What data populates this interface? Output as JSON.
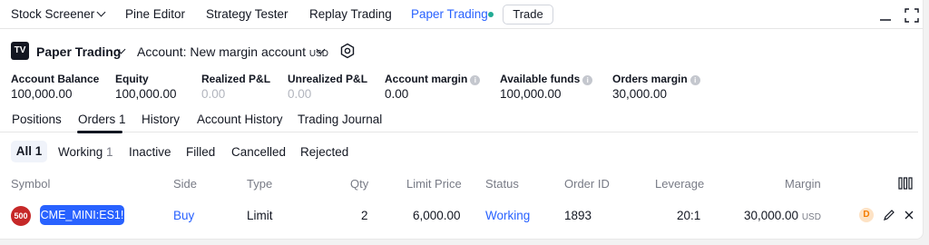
{
  "topbar": {
    "tabs": [
      "Stock Screener",
      "Pine Editor",
      "Strategy Tester",
      "Replay Trading",
      "Paper Trading"
    ],
    "trade_label": "Trade"
  },
  "account": {
    "title": "Paper Trading",
    "selector_label": "Account: New margin account",
    "currency": "USD"
  },
  "metrics": [
    {
      "label": "Account Balance",
      "value": "100,000.00"
    },
    {
      "label": "Equity",
      "value": "100,000.00"
    },
    {
      "label": "Realized P&L",
      "value": "0.00"
    },
    {
      "label": "Unrealized P&L",
      "value": "0.00"
    },
    {
      "label": "Account margin",
      "value": "0.00"
    },
    {
      "label": "Available funds",
      "value": "100,000.00"
    },
    {
      "label": "Orders margin",
      "value": "30,000.00"
    }
  ],
  "main_tabs": [
    "Positions",
    "Orders 1",
    "History",
    "Account History",
    "Trading Journal"
  ],
  "sub_tabs": {
    "all": "All 1",
    "working": "Working",
    "working_count": "1",
    "inactive": "Inactive",
    "filled": "Filled",
    "cancelled": "Cancelled",
    "rejected": "Rejected"
  },
  "table": {
    "columns": [
      "Symbol",
      "Side",
      "Type",
      "Qty",
      "Limit Price",
      "Status",
      "Order ID",
      "Leverage",
      "Margin"
    ],
    "row": {
      "badge": "500",
      "symbol": "CME_MINI:ES1!",
      "side": "Buy",
      "type": "Limit",
      "qty": "2",
      "limit_price": "6,000.00",
      "status": "Working",
      "order_id": "1893",
      "leverage": "20:1",
      "margin": "30,000.00",
      "margin_currency": "USD",
      "d_badge": "D"
    }
  },
  "colors": {
    "accent": "#2962ff",
    "status_dot": "#22ab94",
    "badge_red": "#c62828",
    "muted": "#b2b5be"
  }
}
